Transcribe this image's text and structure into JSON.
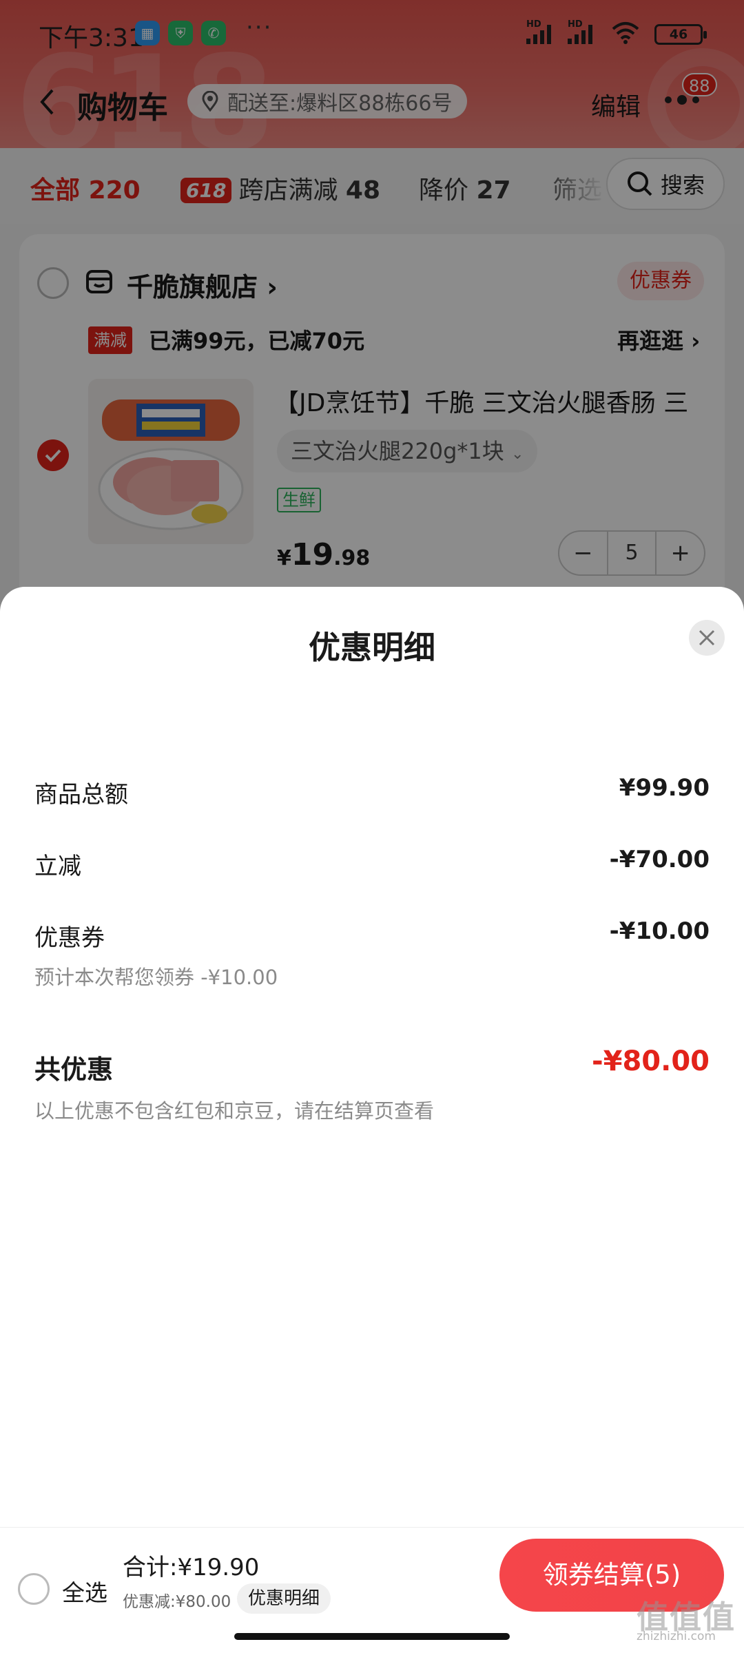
{
  "status_bar": {
    "time": "下午3:31",
    "more": "···",
    "hd1": "HD",
    "hd2": "HD",
    "battery": "46"
  },
  "header": {
    "title": "购物车",
    "address": "配送至:爆料区88栋66号",
    "edit": "编辑",
    "badge": "88"
  },
  "tabs": {
    "all_label": "全部",
    "all_count": "220",
    "cross_tag": "618",
    "cross_label": "跨店满减",
    "cross_count": "48",
    "drop_label": "降价",
    "drop_count": "27",
    "filter_label": "筛选",
    "search": "搜索"
  },
  "store": {
    "name": "千脆旗舰店",
    "coupon": "优惠券",
    "promo_tag": "满减",
    "promo_text": "已满99元，已减70元",
    "promo_more": "再逛逛"
  },
  "product": {
    "title": "【JD烹饪节】千脆 三文治火腿香肠 三",
    "spec": "三文治火腿220g*1块",
    "fresh_tag": "生鲜",
    "currency": "¥",
    "price_int": "19",
    "price_dec": ".98",
    "quantity": "5",
    "minus": "−",
    "plus": "+"
  },
  "sheet": {
    "title": "优惠明细",
    "rows": [
      {
        "label": "商品总额",
        "value": "¥99.90"
      },
      {
        "label": "立减",
        "value": "-¥70.00"
      },
      {
        "label": "优惠券",
        "value": "-¥10.00"
      }
    ],
    "coupon_note": "预计本次帮您领券 -¥10.00",
    "total_label": "共优惠",
    "total_value": "-¥80.00",
    "disclaimer": "以上优惠不包含红包和京豆，请在结算页查看"
  },
  "bottom": {
    "select_all": "全选",
    "sum": "合计:¥19.90",
    "discount": "优惠减:¥80.00",
    "detail": "优惠明细",
    "checkout": "领券结算(5)"
  },
  "watermark": {
    "main": "值值值",
    "sub": "zhizhizhi.com"
  },
  "colors": {
    "accent": "#e2231a",
    "hero": "#e8564f",
    "fresh": "#2db35c"
  }
}
